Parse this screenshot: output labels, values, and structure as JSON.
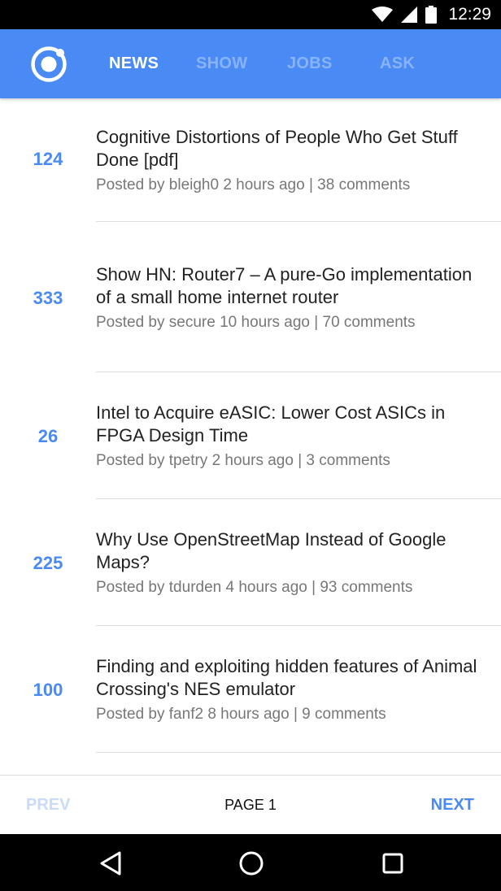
{
  "status_bar": {
    "time": "12:29",
    "icons": [
      "wifi-icon",
      "signal-icon",
      "battery-icon"
    ]
  },
  "header": {
    "logo_icon": "ionic-logo-icon",
    "tabs": [
      {
        "label": "NEWS",
        "active": true
      },
      {
        "label": "SHOW",
        "active": false
      },
      {
        "label": "JOBS",
        "active": false
      },
      {
        "label": "ASK",
        "active": false
      }
    ]
  },
  "stories": [
    {
      "score": "124",
      "title": "Cognitive Distortions of People Who Get Stuff Done [pdf]",
      "meta": "Posted by bleigh0 2 hours ago | 38 comments"
    },
    {
      "score": "333",
      "title": "Show HN: Router7 – A pure-Go implementation of a small home internet router",
      "meta": "Posted by secure 10 hours ago | 70 comments"
    },
    {
      "score": "26",
      "title": "Intel to Acquire eASIC: Lower Cost ASICs in FPGA Design Time",
      "meta": "Posted by tpetry 2 hours ago | 3 comments"
    },
    {
      "score": "225",
      "title": "Why Use OpenStreetMap Instead of Google Maps?",
      "meta": "Posted by tdurden 4 hours ago | 93 comments"
    },
    {
      "score": "100",
      "title": "Finding and exploiting hidden features of Animal Crossing's NES emulator",
      "meta": "Posted by fanf2 8 hours ago | 9 comments"
    }
  ],
  "pagination": {
    "prev_label": "PREV",
    "page_label": "PAGE 1",
    "next_label": "NEXT"
  },
  "colors": {
    "accent": "#4a8af4",
    "header_bg": "#4a8af4",
    "disabled": "#c9dbf9"
  },
  "system_nav": {
    "icons": [
      "back-icon",
      "home-icon",
      "recents-icon"
    ]
  }
}
